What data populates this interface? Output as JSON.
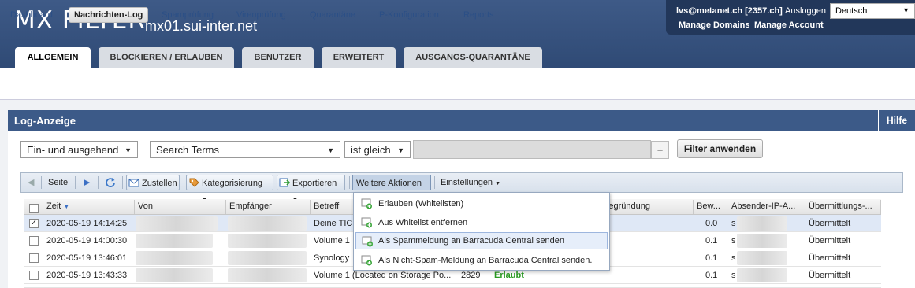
{
  "header": {
    "brand": "MX FILTER",
    "host": "mx01.sui-inter.net",
    "user": "lvs@metanet.ch [2357.ch]",
    "logout": "Ausloggen",
    "language": "Deutsch",
    "manage_domains": "Manage Domains",
    "manage_account": "Manage Account"
  },
  "tabs": [
    {
      "label": "ALLGEMEIN",
      "active": true
    },
    {
      "label": "BLOCKIEREN / ERLAUBEN"
    },
    {
      "label": "BENUTZER"
    },
    {
      "label": "ERWEITERT"
    },
    {
      "label": "AUSGANGS-QUARANTÄNE"
    }
  ],
  "subnav": [
    {
      "label": "Dashboard"
    },
    {
      "label": "Nachrichten-Log",
      "active": true
    },
    {
      "label": "Spamprüfung"
    },
    {
      "label": "Virenprüfung"
    },
    {
      "label": "Quarantäne"
    },
    {
      "label": "IP-Konfiguration"
    },
    {
      "label": "Reports"
    }
  ],
  "panel": {
    "title": "Log-Anzeige",
    "help": "Hilfe"
  },
  "filter": {
    "direction": "Ein- und ausgehend",
    "field": "Search Terms",
    "operator": "ist gleich",
    "value": "",
    "add": "+",
    "apply": "Filter anwenden"
  },
  "toolbar": {
    "page": "Seite",
    "deliver": "Zustellen",
    "categorize": "Kategorisierung",
    "export": "Exportieren",
    "more_actions": "Weitere Aktionen",
    "settings": "Einstellungen"
  },
  "columns": [
    "Zeit",
    "Von",
    "Empfänger",
    "Betreff",
    "Begründung",
    "Bew...",
    "Absender-IP-A...",
    "Übermittlungs-..."
  ],
  "rows": [
    {
      "checked": true,
      "time": "2020-05-19 14:14:25",
      "subject": "Deine TIC",
      "size": "",
      "action": "",
      "score": "0.0",
      "ip": "s",
      "status": "Übermittelt"
    },
    {
      "checked": false,
      "time": "2020-05-19 14:00:30",
      "subject": "Volume 1",
      "size": "",
      "action": "",
      "score": "0.1",
      "ip": "s",
      "status": "Übermittelt"
    },
    {
      "checked": false,
      "time": "2020-05-19 13:46:01",
      "subject": "Synology",
      "size": "",
      "action": "",
      "score": "0.1",
      "ip": "s",
      "status": "Übermittelt"
    },
    {
      "checked": false,
      "time": "2020-05-19 13:43:33",
      "subject": "Volume 1 (Located on Storage Po...",
      "size": "2829",
      "action": "Erlaubt",
      "score": "0.1",
      "ip": "s",
      "status": "Übermittelt"
    }
  ],
  "menu": [
    {
      "label": "Erlauben (Whitelisten)"
    },
    {
      "label": "Aus Whitelist entfernen"
    },
    {
      "label": "Als Spammeldung an Barracuda Central senden",
      "highlighted": true
    },
    {
      "label": "Als Nicht-Spam-Meldung an Barracuda Central senden."
    }
  ],
  "colors": {
    "header": "#2f4a75",
    "panel": "#3c5a88",
    "allowed": "#2a9b22",
    "link": "#2b4f86"
  }
}
